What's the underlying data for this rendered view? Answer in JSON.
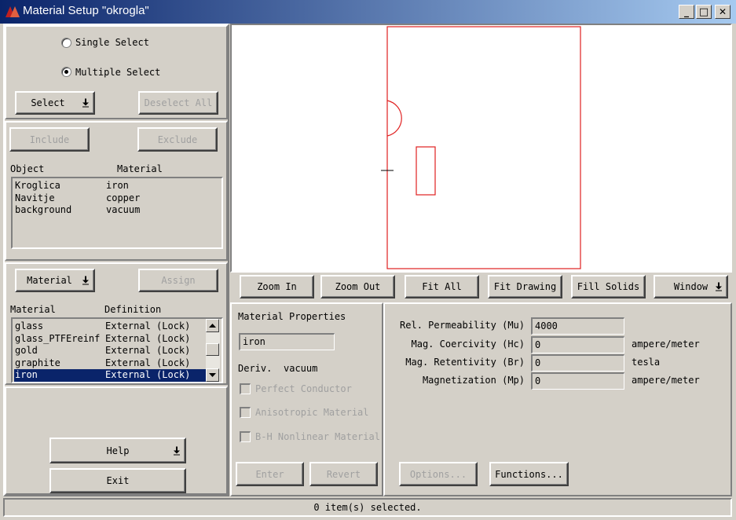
{
  "window": {
    "title": "Material Setup \"okrogla\"",
    "minimize_glyph": "_",
    "maximize_glyph": "□",
    "close_glyph": "✕"
  },
  "selection": {
    "single_label": "Single Select",
    "multiple_label": "Multiple Select",
    "select_button": "Select",
    "deselect_all_button": "Deselect All"
  },
  "objects": {
    "include_button": "Include",
    "exclude_button": "Exclude",
    "col_object": "Object",
    "col_material": "Material",
    "rows": [
      {
        "object": "Kroglica",
        "material": "iron"
      },
      {
        "object": "Navitje",
        "material": "copper"
      },
      {
        "object": "background",
        "material": "vacuum"
      }
    ]
  },
  "materials": {
    "material_button": "Material",
    "assign_button": "Assign",
    "col_material": "Material",
    "col_definition": "Definition",
    "rows": [
      {
        "material": "glass",
        "definition": "External (Lock)"
      },
      {
        "material": "glass_PTFEreinf",
        "definition": "External (Lock)"
      },
      {
        "material": "gold",
        "definition": "External (Lock)"
      },
      {
        "material": "graphite",
        "definition": "External (Lock)"
      },
      {
        "material": "iron",
        "definition": "External (Lock)"
      }
    ]
  },
  "bottom_left": {
    "help_button": "Help",
    "exit_button": "Exit"
  },
  "view_toolbar": {
    "zoom_in": "Zoom In",
    "zoom_out": "Zoom Out",
    "fit_all": "Fit All",
    "fit_drawing": "Fit Drawing",
    "fill_solids": "Fill Solids",
    "window": "Window"
  },
  "properties": {
    "heading": "Material Properties",
    "name_value": "iron",
    "deriv_label": "Deriv.",
    "deriv_value": "vacuum",
    "perfect_conductor": "Perfect Conductor",
    "anisotropic": "Anisotropic Material",
    "bh_nonlinear": "B-H Nonlinear Material",
    "enter_button": "Enter",
    "revert_button": "Revert"
  },
  "parameters": {
    "rows": [
      {
        "label": "Rel. Permeability (Mu)",
        "value": "4000",
        "unit": ""
      },
      {
        "label": "Mag. Coercivity (Hc)",
        "value": "0",
        "unit": "ampere/meter"
      },
      {
        "label": "Mag. Retentivity (Br)",
        "value": "0",
        "unit": "tesla"
      },
      {
        "label": "Magnetization (Mp)",
        "value": "0",
        "unit": "ampere/meter"
      }
    ],
    "options_button": "Options...",
    "functions_button": "Functions..."
  },
  "status": {
    "text": "0 item(s) selected."
  },
  "colors": {
    "drawing": "#e02020",
    "selection": "#0a246a"
  }
}
